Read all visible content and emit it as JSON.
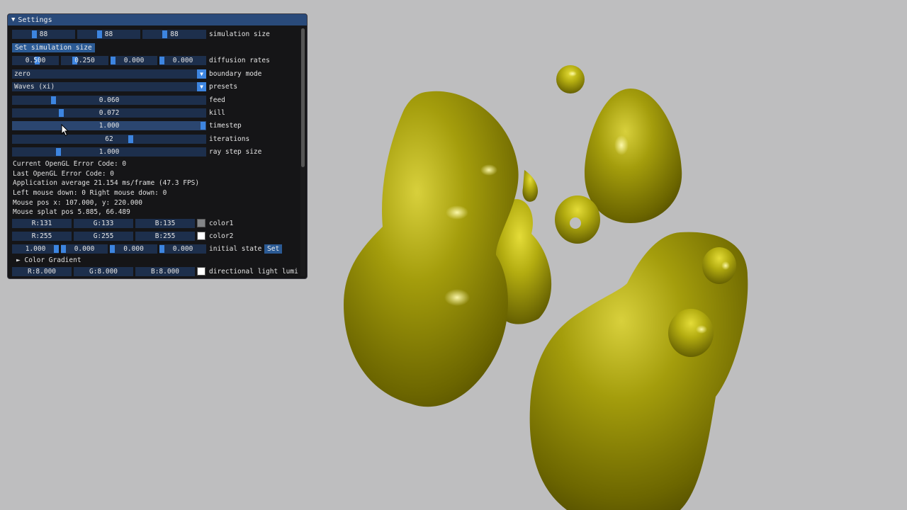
{
  "window": {
    "title": "Settings"
  },
  "controls": {
    "simulation_size": {
      "values": [
        "88",
        "88",
        "88"
      ],
      "label": "simulation size"
    },
    "set_size_button": "Set simulation size",
    "diffusion_rates": {
      "values": [
        "0.500",
        "0.250",
        "0.000",
        "0.000"
      ],
      "label": "diffusion rates"
    },
    "boundary_mode": {
      "value": "zero",
      "label": "boundary mode"
    },
    "presets": {
      "value": "Waves (xi)",
      "label": "presets"
    },
    "feed": {
      "value": "0.060",
      "label": "feed"
    },
    "kill": {
      "value": "0.072",
      "label": "kill"
    },
    "timestep": {
      "value": "1.000",
      "label": "timestep"
    },
    "iterations": {
      "value": "62",
      "label": "iterations"
    },
    "ray_step_size": {
      "value": "1.000",
      "label": "ray step size"
    }
  },
  "info": {
    "current_error": "Current OpenGL Error Code: 0",
    "last_error": "Last OpenGL Error Code: 0",
    "app_average": "Application average 21.154 ms/frame (47.3 FPS)",
    "mouse_down": "Left mouse down: 0 Right mouse down: 0",
    "mouse_pos": "Mouse pos x: 107.000, y: 220.000",
    "mouse_splat": "Mouse splat pos 5.885, 66.489"
  },
  "colors": {
    "color1": {
      "r": "R:131",
      "g": "G:133",
      "b": "B:135",
      "label": "color1",
      "hex": "#838587"
    },
    "color2": {
      "r": "R:255",
      "g": "G:255",
      "b": "B:255",
      "label": "color2",
      "hex": "#ffffff"
    }
  },
  "initial_state": {
    "values": [
      "1.000",
      "0.000",
      "0.000",
      "0.000"
    ],
    "label": "initial state",
    "button": "Set"
  },
  "color_gradient": {
    "label": "Color Gradient"
  },
  "directional_light": {
    "r": "R:8.000",
    "g": "G:8.000",
    "b": "B:8.000",
    "label": "directional light lumi",
    "hex": "#ffffff"
  },
  "icons": {
    "collapse": "triangle-down-icon",
    "tree_node": "triangle-right-icon",
    "combo_arrow": "triangle-down-icon"
  },
  "theme": {
    "background": "#bebebf",
    "blob_color": "#a6a000",
    "accent": "#3d85e0",
    "title_bar": "#294a7a"
  }
}
